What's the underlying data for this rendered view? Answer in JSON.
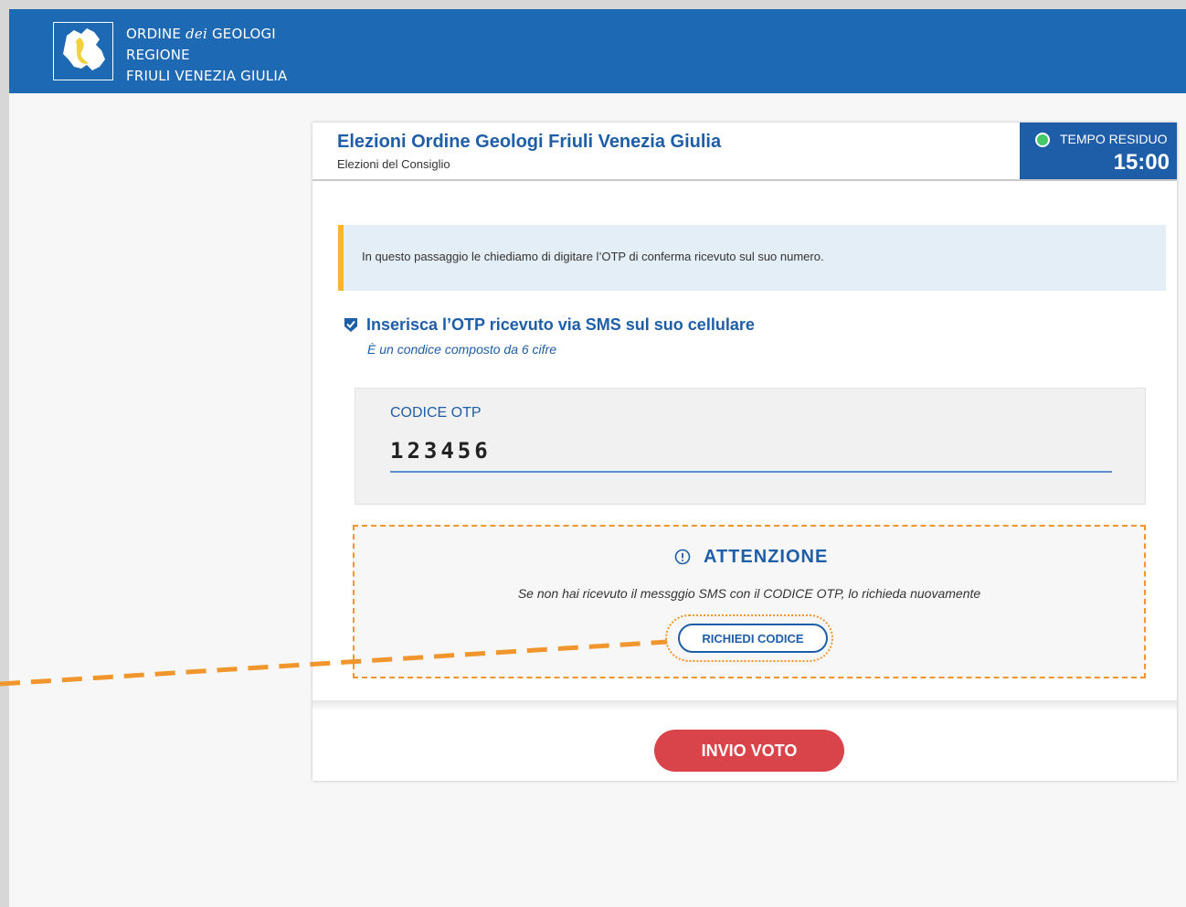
{
  "header": {
    "org_line1_prefix": "ORDINE",
    "org_line1_dei": "dei",
    "org_line1_suffix": "GEOLOGI",
    "org_line2": "REGIONE",
    "org_line3": "FRIULI VENEZIA GIULIA",
    "brand_color": "#1e69b4",
    "logo_icon": "region-map-icon"
  },
  "card": {
    "title": "Elezioni Ordine Geologi Friuli Venezia Giulia",
    "subtitle": "Elezioni del Consiglio"
  },
  "timer": {
    "label": "TEMPO RESIDUO",
    "value": "15:00",
    "status_color": "#45c76c"
  },
  "info": {
    "text": "In questo passaggio le chiediamo di digitare l’OTP  di conferma ricevuto sul suo numero.",
    "accent_color": "#f5b731"
  },
  "otp": {
    "title": "Inserisca l’OTP ricevuto via SMS  sul suo cellulare",
    "hint": "È un condice composto da 6 cifre",
    "field_label": "CODICE OTP",
    "value": "123456"
  },
  "attention": {
    "title": "ATTENZIONE",
    "text": "Se non hai ricevuto il messggio SMS con il CODICE OTP, lo richieda nuovamente",
    "button_label": "RICHIEDI CODICE",
    "highlight_color": "#f0962c"
  },
  "footer": {
    "vote_button_label": "INVIO VOTO",
    "vote_button_color": "#d9444b"
  }
}
